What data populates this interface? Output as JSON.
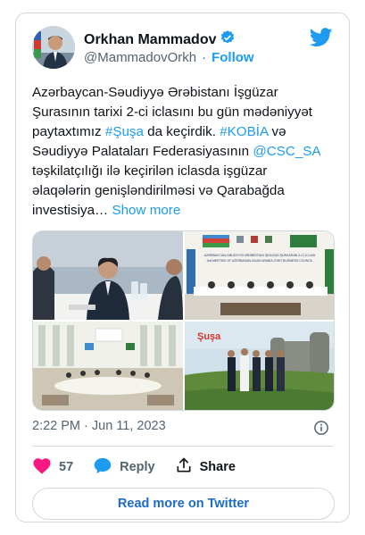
{
  "author": {
    "name": "Orkhan Mammadov",
    "handle": "@MammadovOrkh",
    "separator": "·",
    "follow_label": "Follow"
  },
  "tweet": {
    "line1": "Azərbaycan-Səudiyyə Ərəbistanı İşgüzar",
    "line2": "Şurasının tarixi 2-ci iclasını bu gün mədəniyyət",
    "line3_pre": "paytaxtımız ",
    "hashtag_susa": "#Şuşa",
    "line3_mid": " da keçirdik. ",
    "hashtag_kobia": "#KOBİA",
    "line3_post": " və",
    "line4_pre": "Səudiyyə Palataları Federasiyasının ",
    "mention_csc": "@CSC_SA",
    "line5": "təşkilatçılığı ilə keçirilən iclasda işgüzar",
    "line6": "əlaqələrin genişləndirilməsi və Qarabağda",
    "line7": "investisiya…",
    "show_more": "Show more"
  },
  "media": {
    "banner_title": "AZƏRBAYCAN-SƏUDIYYƏ ƏRƏBİSTANI İŞGÜZAR ŞURASININ 2-Cİ İCLASI",
    "banner_subtitle": "2nd MEETING OF AZERBAIJAN-SAUDI ARABIA JOINT BUSINESS COUNCIL",
    "susa_label": "Şuşa"
  },
  "meta": {
    "time": "2:22 PM",
    "separator": "·",
    "date": "Jun 11, 2023"
  },
  "actions": {
    "likes": "57",
    "reply_label": "Reply",
    "share_label": "Share"
  },
  "read_more_label": "Read more on Twitter",
  "colors": {
    "accent": "#1d9bf0",
    "like": "#f91880",
    "verified": "#1d9bf0"
  }
}
